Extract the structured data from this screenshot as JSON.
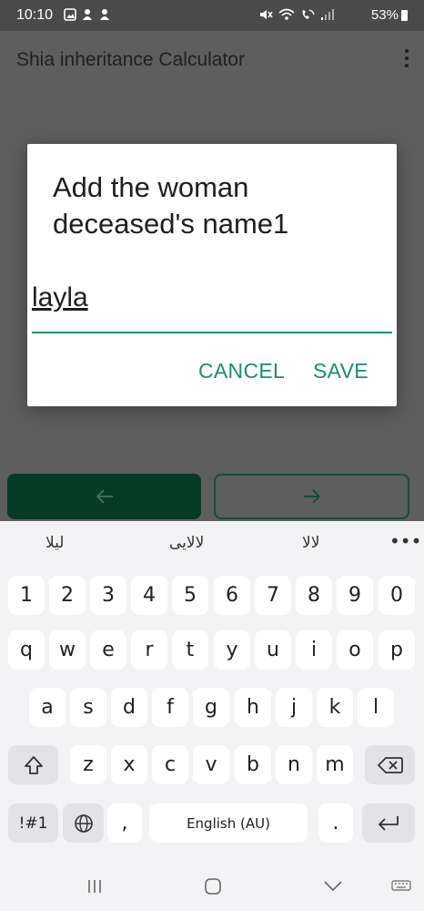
{
  "status": {
    "time": "10:10",
    "battery": "53%"
  },
  "app": {
    "title": "Shia inheritance Calculator"
  },
  "dialog": {
    "title": "Add the woman deceased's name1",
    "input_value": "layla",
    "cancel_label": "CANCEL",
    "save_label": "SAVE"
  },
  "keyboard": {
    "suggestions": [
      "ليلا",
      "لالایی",
      "لالا"
    ],
    "row_numbers": [
      "1",
      "2",
      "3",
      "4",
      "5",
      "6",
      "7",
      "8",
      "9",
      "0"
    ],
    "row1": [
      "q",
      "w",
      "e",
      "r",
      "t",
      "y",
      "u",
      "i",
      "o",
      "p"
    ],
    "row2": [
      "a",
      "s",
      "d",
      "f",
      "g",
      "h",
      "j",
      "k",
      "l"
    ],
    "row3": [
      "z",
      "x",
      "c",
      "v",
      "b",
      "n",
      "m"
    ],
    "symbols_label": "!#1",
    "comma": ",",
    "space_label": "English (AU)",
    "period": "."
  },
  "colors": {
    "accent": "#1b8e73",
    "dark_green": "#043b25",
    "dim": "#5e5e5e"
  }
}
